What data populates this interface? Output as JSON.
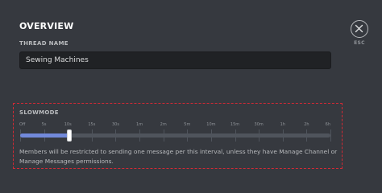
{
  "overview": {
    "title": "OVERVIEW",
    "thread_name_label": "THREAD NAME",
    "thread_name_value": "Sewing Machines"
  },
  "close": {
    "esc_label": "ESC"
  },
  "slowmode": {
    "label": "SLOWMODE",
    "ticks": [
      "Off",
      "5s",
      "10s",
      "15s",
      "30s",
      "1m",
      "2m",
      "5m",
      "10m",
      "15m",
      "30m",
      "1h",
      "2h",
      "6h"
    ],
    "selected_index": 2,
    "selected_value": "10s",
    "helper_text": "Members will be restricted to sending one message per this interval, unless they have Manage Channel or Manage Messages permissions."
  }
}
